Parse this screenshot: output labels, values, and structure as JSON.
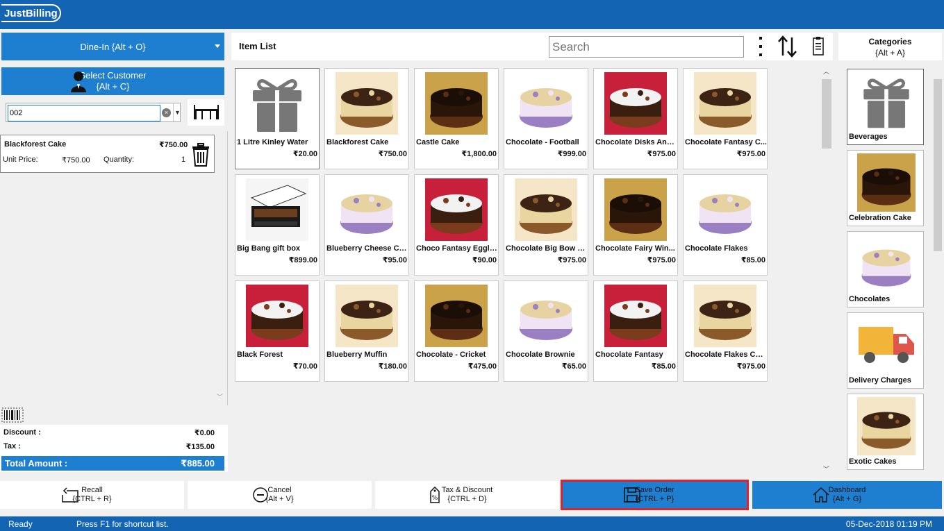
{
  "app": {
    "logo_text": "JustBilling"
  },
  "left": {
    "order_type": "Dine-In {Alt + O}",
    "select_customer_line1": "Select Customer",
    "select_customer_line2": "{Alt + C}",
    "customer_value": "002",
    "order_item": {
      "name": "Blackforest Cake",
      "price": "₹750.00",
      "unit_price_label": "Unit Price:",
      "unit_price": "₹750.00",
      "quantity_label": "Quantity:",
      "quantity": "1"
    },
    "discount_label": "Discount :",
    "discount_value": "₹0.00",
    "tax_label": "Tax :",
    "tax_value": "₹135.00",
    "total_label": "Total Amount :",
    "total_value": "₹885.00"
  },
  "header": {
    "item_list_title": "Item List",
    "search_placeholder": "Search",
    "categories_line1": "Categories",
    "categories_line2": "{Alt + A}"
  },
  "items": [
    {
      "name": "1 Litre Kinley Water",
      "price": "₹20.00",
      "icon": "gift-icon"
    },
    {
      "name": "Blackforest Cake",
      "price": "₹750.00",
      "icon": "cake-photo"
    },
    {
      "name": "Castle Cake",
      "price": "₹1,800.00",
      "icon": "cake-photo"
    },
    {
      "name": "Chocolate - Football",
      "price": "₹999.00",
      "icon": "cake-photo"
    },
    {
      "name": "Chocolate Disks And...",
      "price": "₹975.00",
      "icon": "cake-photo"
    },
    {
      "name": "Chocolate Fantasy C...",
      "price": "₹975.00",
      "icon": "cake-photo"
    },
    {
      "name": "Big Bang gift box",
      "price": "₹899.00",
      "icon": "gift-box-photo"
    },
    {
      "name": "Blueberry Cheese Ca...",
      "price": "₹95.00",
      "icon": "cake-photo"
    },
    {
      "name": "Choco Fantasy Eggle...",
      "price": "₹90.00",
      "icon": "cake-photo"
    },
    {
      "name": "Chocolate Big Bow C...",
      "price": "₹975.00",
      "icon": "cake-photo"
    },
    {
      "name": "Chocolate Fairy Win...",
      "price": "₹975.00",
      "icon": "cupcake-photo"
    },
    {
      "name": "Chocolate Flakes",
      "price": "₹85.00",
      "icon": "cake-photo"
    },
    {
      "name": "Black Forest",
      "price": "₹70.00",
      "icon": "cake-photo"
    },
    {
      "name": "Blueberry Muffin",
      "price": "₹180.00",
      "icon": "muffin-photo"
    },
    {
      "name": "Chocolate - Cricket",
      "price": "₹475.00",
      "icon": "cake-photo"
    },
    {
      "name": "Chocolate Brownie",
      "price": "₹65.00",
      "icon": "brownie-photo"
    },
    {
      "name": "Chocolate Fantasy",
      "price": "₹85.00",
      "icon": "cake-photo"
    },
    {
      "name": "Chocolate Flakes Cake",
      "price": "₹975.00",
      "icon": "cake-photo"
    }
  ],
  "categories": [
    {
      "name": "Beverages",
      "icon": "gift-icon"
    },
    {
      "name": "Celebration Cake",
      "icon": "cake-photo"
    },
    {
      "name": "Chocolates",
      "icon": "chocolate-photo"
    },
    {
      "name": "Delivery Charges",
      "icon": "truck-icon"
    },
    {
      "name": "Exotic Cakes",
      "icon": "cake-photo"
    }
  ],
  "buttons": {
    "recall_line1": "Recall",
    "recall_line2": "{CTRL + R}",
    "cancel_line1": "Cancel",
    "cancel_line2": "{Alt + V}",
    "tax_line1": "Tax & Discount",
    "tax_line2": "{CTRL + D}",
    "save_line1": "Save Order",
    "save_line2": "{CTRL + P}",
    "dash_line1": "Dashboard",
    "dash_line2": "{Alt + G}"
  },
  "status": {
    "state": "Ready",
    "hint": "Press F1 for shortcut list.",
    "datetime": "05-Dec-2018 01:19 PM"
  },
  "colors": {
    "brand_blue": "#1464b4",
    "button_blue": "#1e7fd0",
    "highlight_red": "#e0232a"
  }
}
